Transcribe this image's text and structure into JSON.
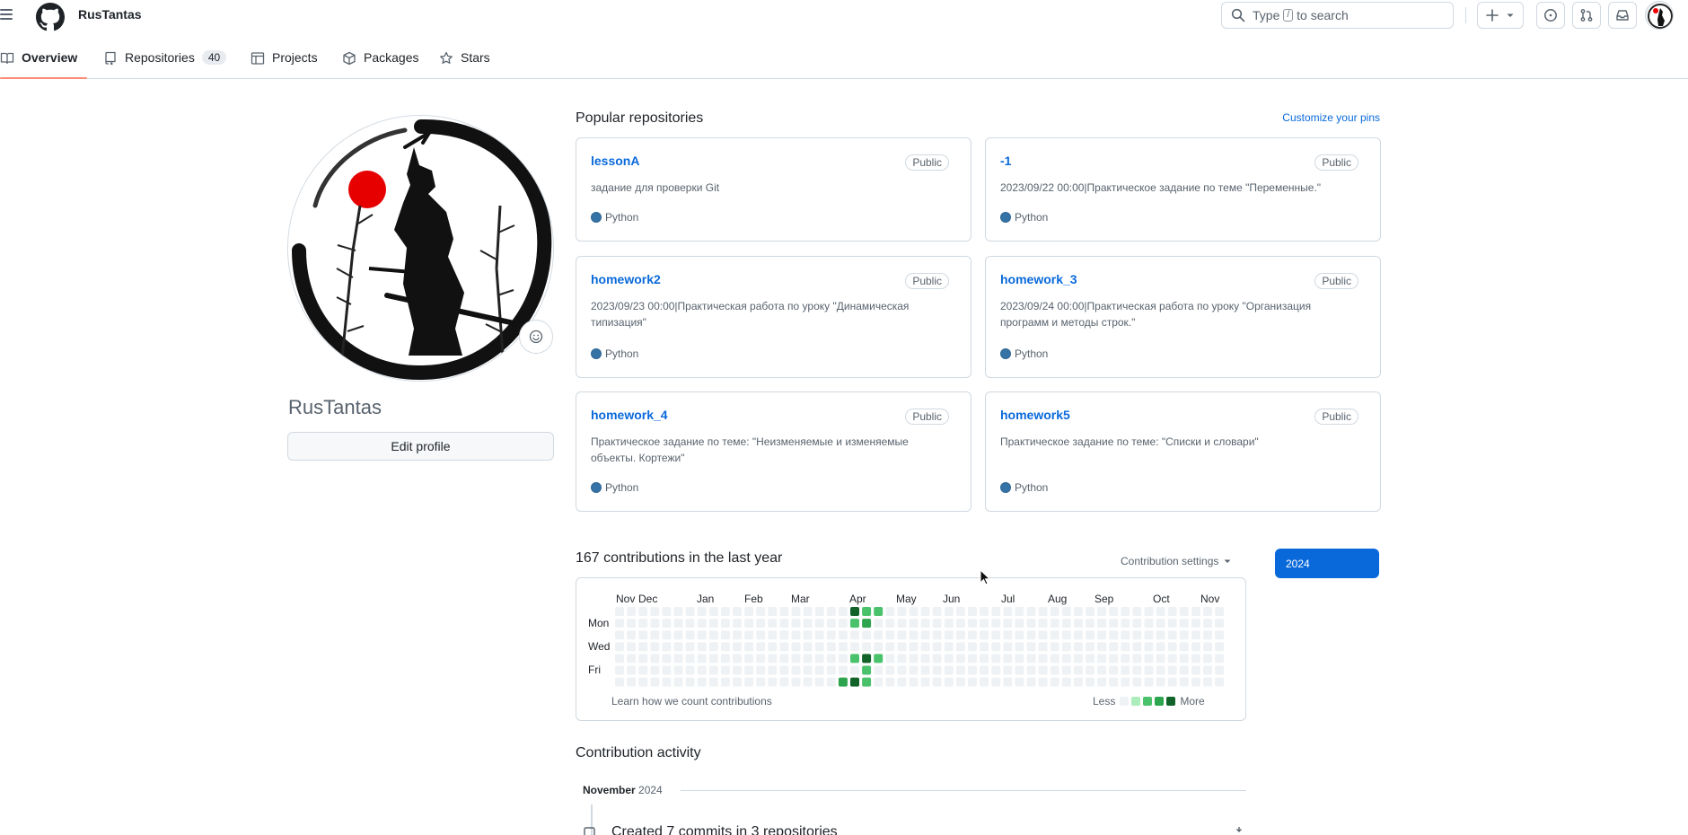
{
  "header": {
    "username": "RusTantas",
    "search": {
      "prefix": "Type",
      "key": "/",
      "suffix": "to search"
    },
    "icons": [
      "menu-icon",
      "github-logo-icon",
      "search-icon",
      "plus-icon",
      "issues-icon",
      "pull-requests-icon",
      "inbox-icon",
      "avatar"
    ]
  },
  "tabs": [
    {
      "label": "Overview",
      "icon": "book-icon",
      "active": true
    },
    {
      "label": "Repositories",
      "icon": "repo-icon",
      "count": "40"
    },
    {
      "label": "Projects",
      "icon": "table-icon"
    },
    {
      "label": "Packages",
      "icon": "package-icon"
    },
    {
      "label": "Stars",
      "icon": "star-icon"
    }
  ],
  "profile": {
    "name": "RusTantas",
    "edit_label": "Edit profile"
  },
  "popular": {
    "title": "Popular repositories",
    "customize": "Customize your pins",
    "repos": [
      {
        "name": "lessonA",
        "visibility": "Public",
        "description": "задание для проверки Git",
        "language": "Python"
      },
      {
        "name": "-1",
        "visibility": "Public",
        "description": "2023/09/22 00:00|Практическое задание по теме \"Переменные.\"",
        "language": "Python"
      },
      {
        "name": "homework2",
        "visibility": "Public",
        "description": "2023/09/23 00:00|Практическая работа по уроку \"Динамическая типизация\"",
        "language": "Python"
      },
      {
        "name": "homework_3",
        "visibility": "Public",
        "description": "2023/09/24 00:00|Практическая работа по уроку \"Организация программ и методы строк.\"",
        "language": "Python"
      },
      {
        "name": "homework_4",
        "visibility": "Public",
        "description": "Практическое задание по теме: \"Неизменяемые и изменяемые объекты. Кортежи\"",
        "language": "Python"
      },
      {
        "name": "homework5",
        "visibility": "Public",
        "description": "Практическое задание по теме: \"Списки и словари\"",
        "language": "Python"
      }
    ]
  },
  "contributions": {
    "title": "167 contributions in the last year",
    "settings": "Contribution settings",
    "year": "2024",
    "months": [
      "Nov",
      "Dec",
      "Jan",
      "Feb",
      "Mar",
      "Apr",
      "May",
      "Jun",
      "Jul",
      "Aug",
      "Sep",
      "Oct",
      "Nov"
    ],
    "days": [
      "Mon",
      "Wed",
      "Fri"
    ],
    "learn": "Learn how we count contributions",
    "legend_less": "Less",
    "legend_more": "More",
    "colors": [
      "#eff2f5",
      "#aceebb",
      "#4ac26b",
      "#2da44e",
      "#116329"
    ],
    "levels": [
      [
        0,
        0,
        0,
        0,
        0,
        0,
        0,
        0,
        0,
        0,
        0,
        0,
        0,
        0,
        0,
        0,
        0,
        0,
        0,
        0,
        4,
        2,
        2,
        0,
        0,
        0,
        0,
        0,
        0,
        0,
        0,
        0,
        0,
        0,
        0,
        0,
        0,
        0,
        0,
        0,
        0,
        0,
        0,
        0,
        0,
        0,
        0,
        0,
        0,
        0,
        0,
        0
      ],
      [
        0,
        0,
        0,
        0,
        0,
        0,
        0,
        0,
        0,
        0,
        0,
        0,
        0,
        0,
        0,
        0,
        0,
        0,
        0,
        0,
        2,
        3,
        0,
        0,
        0,
        0,
        0,
        0,
        0,
        0,
        0,
        0,
        0,
        0,
        0,
        0,
        0,
        0,
        0,
        0,
        0,
        0,
        0,
        0,
        0,
        0,
        0,
        0,
        0,
        0,
        0,
        0
      ],
      [
        0,
        0,
        0,
        0,
        0,
        0,
        0,
        0,
        0,
        0,
        0,
        0,
        0,
        0,
        0,
        0,
        0,
        0,
        0,
        0,
        0,
        0,
        0,
        0,
        0,
        0,
        0,
        0,
        0,
        0,
        0,
        0,
        0,
        0,
        0,
        0,
        0,
        0,
        0,
        0,
        0,
        0,
        0,
        0,
        0,
        0,
        0,
        0,
        0,
        0,
        0,
        0
      ],
      [
        0,
        0,
        0,
        0,
        0,
        0,
        0,
        0,
        0,
        0,
        0,
        0,
        0,
        0,
        0,
        0,
        0,
        0,
        0,
        0,
        0,
        0,
        0,
        0,
        0,
        0,
        0,
        0,
        0,
        0,
        0,
        0,
        0,
        0,
        0,
        0,
        0,
        0,
        0,
        0,
        0,
        0,
        0,
        0,
        0,
        0,
        0,
        0,
        0,
        0,
        0,
        0
      ],
      [
        0,
        0,
        0,
        0,
        0,
        0,
        0,
        0,
        0,
        0,
        0,
        0,
        0,
        0,
        0,
        0,
        0,
        0,
        0,
        0,
        2,
        4,
        2,
        0,
        0,
        0,
        0,
        0,
        0,
        0,
        0,
        0,
        0,
        0,
        0,
        0,
        0,
        0,
        0,
        0,
        0,
        0,
        0,
        0,
        0,
        0,
        0,
        0,
        0,
        0,
        0,
        0
      ],
      [
        0,
        0,
        0,
        0,
        0,
        0,
        0,
        0,
        0,
        0,
        0,
        0,
        0,
        0,
        0,
        0,
        0,
        0,
        0,
        0,
        0,
        2,
        0,
        0,
        0,
        0,
        0,
        0,
        0,
        0,
        0,
        0,
        0,
        0,
        0,
        0,
        0,
        0,
        0,
        0,
        0,
        0,
        0,
        0,
        0,
        0,
        0,
        0,
        0,
        0,
        0,
        0
      ],
      [
        0,
        0,
        0,
        0,
        0,
        0,
        0,
        0,
        0,
        0,
        0,
        0,
        0,
        0,
        0,
        0,
        0,
        0,
        0,
        3,
        4,
        2,
        0,
        0,
        0,
        0,
        0,
        0,
        0,
        0,
        0,
        0,
        0,
        0,
        0,
        0,
        0,
        0,
        0,
        0,
        0,
        0,
        0,
        0,
        0,
        0,
        0,
        0,
        0,
        0,
        0,
        0
      ]
    ]
  },
  "activity": {
    "title": "Contribution activity",
    "month": "November",
    "year": "2024",
    "item": "Created 7 commits in 3 repositories"
  }
}
